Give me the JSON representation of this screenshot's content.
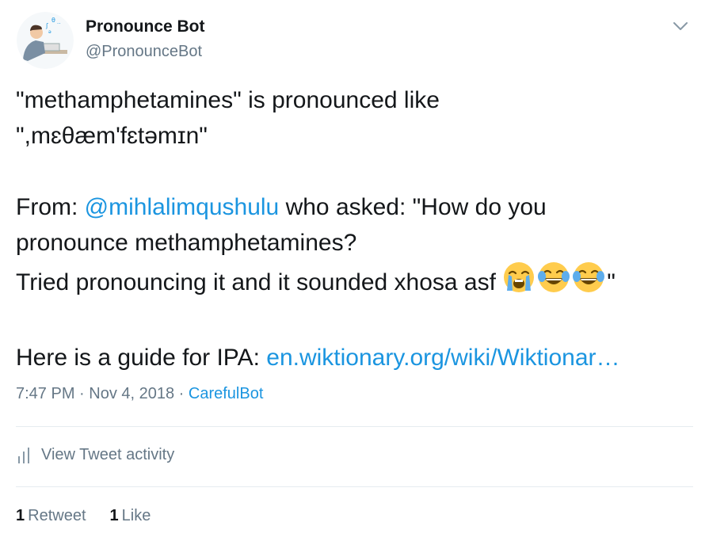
{
  "header": {
    "display_name": "Pronounce Bot",
    "handle": "@PronounceBot",
    "avatar_icon": "person-speaking-icon",
    "menu_icon": "chevron-down-icon"
  },
  "tweet": {
    "line1": "\"methamphetamines\" is pronounced like",
    "line2": "\",mɛθæm'fɛtəmɪn\"",
    "from_prefix": "From: ",
    "mention": "@mihlalimqushulu",
    "from_suffix": " who asked: \"How do you",
    "line4": "pronounce methamphetamines?",
    "line5": "Tried pronouncing it and it sounded xhosa asf ",
    "line5_end": "\"",
    "emojis": [
      "loudly-crying-face",
      "face-with-tears-of-joy",
      "face-with-tears-of-joy"
    ],
    "guide_prefix": "Here is a guide for IPA: ",
    "guide_link": "en.wiktionary.org/wiki/Wiktionar…"
  },
  "meta": {
    "time": "7:47 PM · Nov 4, 2018",
    "separator": " · ",
    "source": "CarefulBot"
  },
  "activity": {
    "icon": "bar-chart-icon",
    "label": "View Tweet activity"
  },
  "stats": {
    "retweet_count": "1",
    "retweet_label": "Retweet",
    "like_count": "1",
    "like_label": "Like"
  },
  "colors": {
    "link": "#1b95e0",
    "secondary_text": "#657786",
    "primary_text": "#14171a",
    "divider": "#e6ecf0"
  }
}
